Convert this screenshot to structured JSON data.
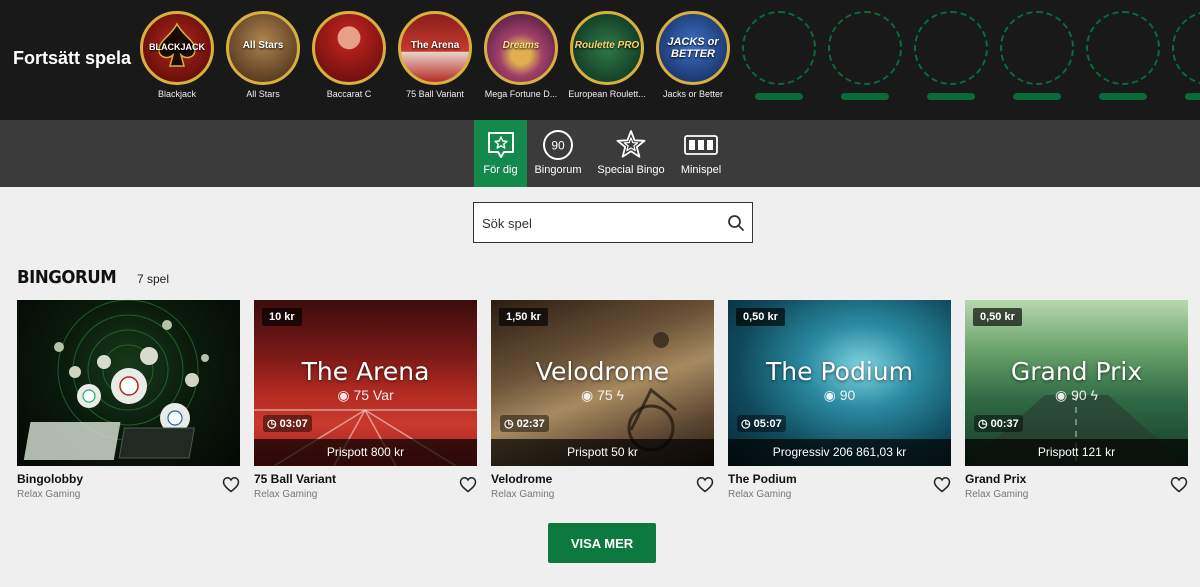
{
  "continue": {
    "title": "Fortsätt spela",
    "games": [
      {
        "label": "Blackjack",
        "thumb_text": "BLACKJACK",
        "bg": "#7a1010"
      },
      {
        "label": "All Stars",
        "thumb_text": "All Stars",
        "bg": "#6b4a2a"
      },
      {
        "label": "Baccarat C",
        "thumb_text": "",
        "bg": "#8a1c1c"
      },
      {
        "label": "75 Ball Variant",
        "thumb_text": "The Arena",
        "bg": "#a3211e"
      },
      {
        "label": "Mega Fortune D...",
        "thumb_text": "Dreams",
        "bg": "#6e2a3e"
      },
      {
        "label": "European Roulett...",
        "thumb_text": "Roulette PRO",
        "bg": "#0f3b27"
      },
      {
        "label": "Jacks or Better",
        "thumb_text": "JACKS or BETTER",
        "bg": "#1a3d7a"
      }
    ],
    "empty_slots": 5
  },
  "tabs": [
    {
      "label": "För dig",
      "icon": "star-chat-icon",
      "active": true
    },
    {
      "label": "Bingorum",
      "icon": "ball-90-icon",
      "active": false
    },
    {
      "label": "Special Bingo",
      "icon": "star-outline-icon",
      "active": false
    },
    {
      "label": "Minispel",
      "icon": "slot-reels-icon",
      "active": false
    }
  ],
  "tab_icon_text": {
    "bingorum": "90"
  },
  "search": {
    "placeholder": "Sök spel",
    "value": ""
  },
  "section": {
    "title": "BINGORUM",
    "count": "7 spel"
  },
  "games": [
    {
      "name": "Bingolobby",
      "provider": "Relax Gaming",
      "stake": "",
      "title_overlay": "",
      "balls": "",
      "timer": "",
      "jackpot": ""
    },
    {
      "name": "75 Ball Variant",
      "provider": "Relax Gaming",
      "stake": "10 kr",
      "title_overlay": "The Arena",
      "balls": "75 Var",
      "timer": "03:07",
      "jackpot": "Prispott 800 kr"
    },
    {
      "name": "Velodrome",
      "provider": "Relax Gaming",
      "stake": "1,50 kr",
      "title_overlay": "Velodrome",
      "balls": "75",
      "timer": "02:37",
      "jackpot": "Prispott 50 kr"
    },
    {
      "name": "The Podium",
      "provider": "Relax Gaming",
      "stake": "0,50 kr",
      "title_overlay": "The Podium",
      "balls": "90",
      "timer": "05:07",
      "jackpot": "Progressiv 206 861,03 kr"
    },
    {
      "name": "Grand Prix",
      "provider": "Relax Gaming",
      "stake": "0,50 kr",
      "title_overlay": "Grand Prix",
      "balls": "90",
      "timer": "00:37",
      "jackpot": "Prispott 121 kr"
    }
  ],
  "show_more_label": "VISA MER",
  "colors": {
    "accent": "#138a4b",
    "button": "#0c7a3e",
    "gold_ring": "#d6b13e",
    "dark": "#191919"
  }
}
